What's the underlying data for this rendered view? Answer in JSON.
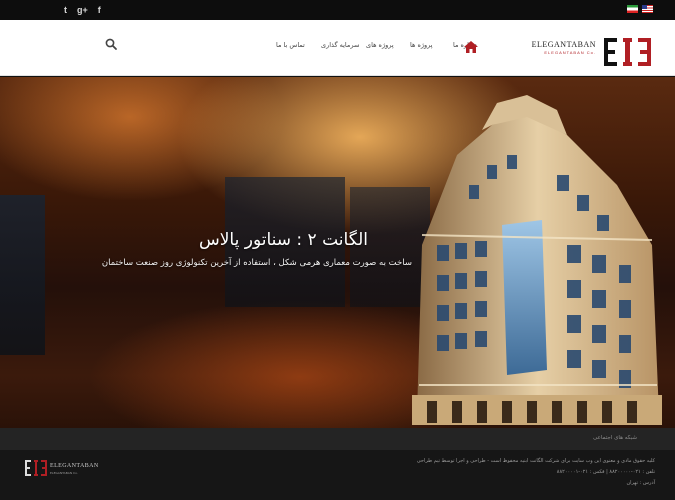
{
  "topbar": {
    "social": [
      {
        "name": "twitter",
        "glyph": "t"
      },
      {
        "name": "google-plus",
        "glyph": "g+"
      },
      {
        "name": "facebook",
        "glyph": "f"
      }
    ],
    "languages": [
      "fa",
      "en"
    ]
  },
  "header": {
    "logo": {
      "main": "ELEGANTABAN",
      "sub": "ELEGANTABAN Co."
    },
    "nav": [
      "درباره ما",
      "پروژه ها",
      "پروژه های",
      "سرمایه گذاری",
      "تماس با ما"
    ],
    "icons": {
      "home": "home-icon",
      "search": "search-icon"
    }
  },
  "hero": {
    "title": "الگانت ۲ : سناتور پالاس",
    "subtitle": "ساخت به صورت معماری هرمی شکل ، استفاده از آخرین تکنولوژی روز صنعت ساختمان"
  },
  "strip": {
    "text": "شبکه های اجتماعی"
  },
  "footer": {
    "logo": {
      "main": "ELEGANTABAN",
      "sub": "ELEGANTABAN Co."
    },
    "lines": [
      "کلیه حقوق مادی و معنوی این وب سایت برای شرکت الگانت ابنیه محفوظ است - طراحی و اجرا توسط تیم طراحی",
      "تلفن : ۰۲۱-۸۸۲۰۰۰۰۰ | فکس : ۰۲۱-۸۸۲۰۰۰۰۱",
      "آدرس : تهران"
    ]
  },
  "colors": {
    "brand_red": "#b01f24",
    "dark": "#161616",
    "topbar": "#0d0d0d"
  }
}
